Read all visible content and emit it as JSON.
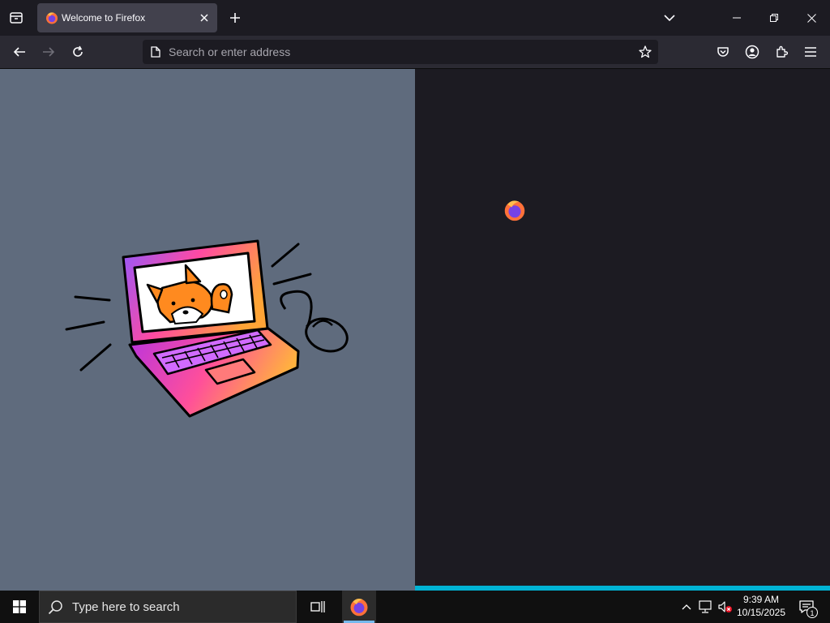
{
  "tab": {
    "title": "Welcome to Firefox"
  },
  "urlbar": {
    "placeholder": "Search or enter address"
  },
  "page": {
    "loading_progress": 1.0
  },
  "taskbar": {
    "search_placeholder": "Type here to search",
    "time": "9:39 AM",
    "date": "10/15/2025",
    "notification_count": "1"
  },
  "colors": {
    "titlebar": "#1c1b22",
    "toolbar": "#2b2a33",
    "tab_active": "#42414d",
    "welcome_left_bg": "#5f6b7d",
    "welcome_right_bg": "#1c1b22",
    "progress": "#00b3d4",
    "taskbar": "#101010"
  },
  "icons": [
    "tab-list-icon",
    "firefox-icon",
    "close-icon",
    "plus-icon",
    "chevron-down-icon",
    "minimize-icon",
    "restore-icon",
    "back-arrow-icon",
    "forward-arrow-icon",
    "reload-icon",
    "page-icon",
    "star-icon",
    "pocket-icon",
    "account-icon",
    "extensions-icon",
    "menu-icon",
    "windows-logo-icon",
    "search-icon",
    "task-view-icon",
    "chevron-up-icon",
    "network-icon",
    "volume-muted-icon",
    "notification-icon"
  ]
}
